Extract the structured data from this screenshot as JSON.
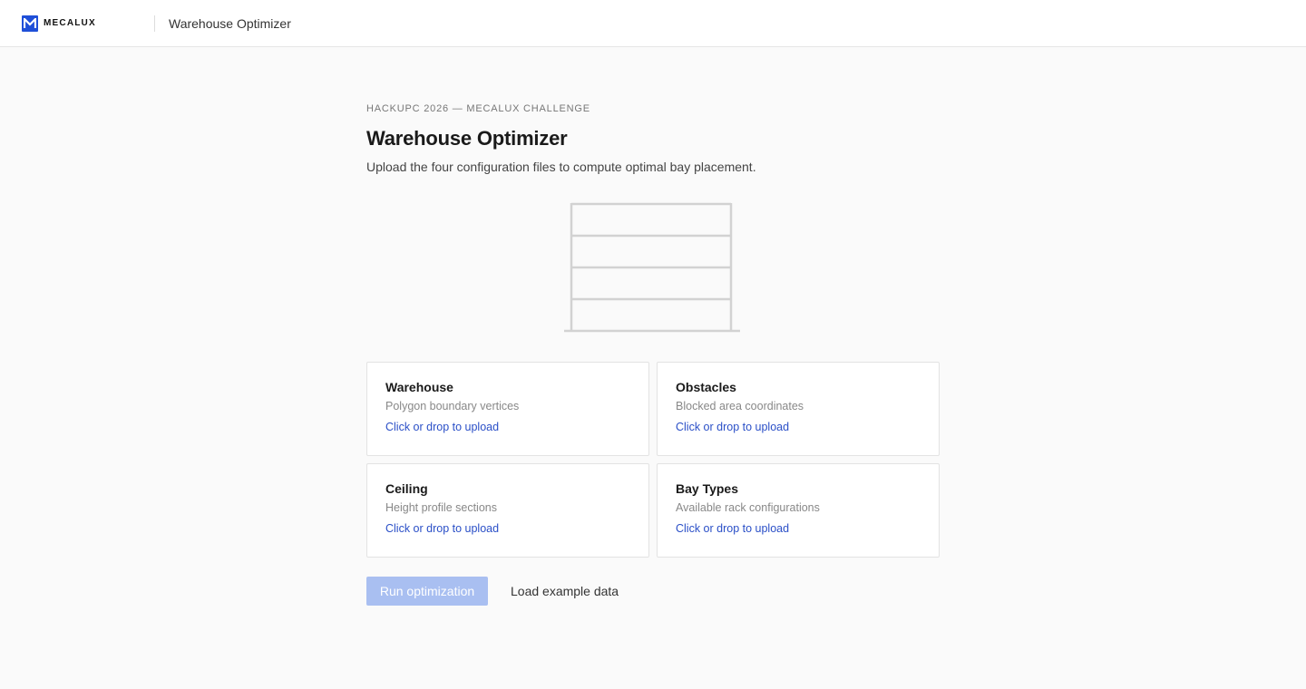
{
  "header": {
    "brand_name": "MECALUX",
    "app_title": "Warehouse Optimizer"
  },
  "main": {
    "eyebrow": "HACKUPC 2026 — MECALUX CHALLENGE",
    "title": "Warehouse Optimizer",
    "subtitle": "Upload the four configuration files to compute optimal bay placement.",
    "upload_cards": [
      {
        "title": "Warehouse",
        "description": "Polygon boundary vertices",
        "action": "Click or drop to upload"
      },
      {
        "title": "Obstacles",
        "description": "Blocked area coordinates",
        "action": "Click or drop to upload"
      },
      {
        "title": "Ceiling",
        "description": "Height profile sections",
        "action": "Click or drop to upload"
      },
      {
        "title": "Bay Types",
        "description": "Available rack configurations",
        "action": "Click or drop to upload"
      }
    ],
    "run_button": "Run optimization",
    "example_button": "Load example data"
  },
  "colors": {
    "accent": "#1f4fd8",
    "link": "#2a4fc7",
    "button_disabled": "#a9bff1"
  },
  "icons": {
    "brand_logo": "mecalux-m-logo",
    "illustration": "shelving-rack-illustration"
  }
}
